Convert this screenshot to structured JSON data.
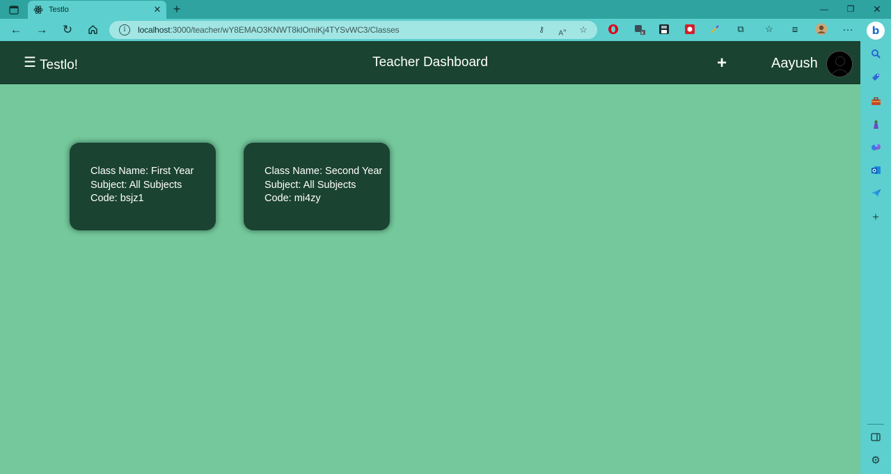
{
  "browser": {
    "tab": {
      "title": "Testlo"
    },
    "address": {
      "host": "localhost",
      "path": ":3000/teacher/wY8EMAO3KNWT8klOmiKj4TYSvWC3/Classes"
    }
  },
  "app": {
    "brand": "Testlo!",
    "menu_glyph": "☰",
    "title": "Teacher Dashboard",
    "add_glyph": "+",
    "user": {
      "name": "Aayush"
    }
  },
  "classes": [
    {
      "name_line": "Class Name: First Year",
      "subject_line": "Subject: All Subjects",
      "code_line": "Code: bsjz1"
    },
    {
      "name_line": "Class Name: Second Year",
      "subject_line": "Subject: All Subjects",
      "code_line": "Code: mi4zy"
    }
  ],
  "colors": {
    "browser_chrome": "#5ccfce",
    "tab_strip": "#2ea39f",
    "header_bg": "#1a4331",
    "page_bg": "#75c89c",
    "card_bg": "#1b4332",
    "text_light": "#ffffff"
  },
  "icons": {
    "sidebar": [
      "search-icon",
      "shopping-tag-icon",
      "toolbox-icon",
      "games-icon",
      "copilot-icon",
      "outlook-icon",
      "send-icon",
      "add-icon"
    ]
  }
}
